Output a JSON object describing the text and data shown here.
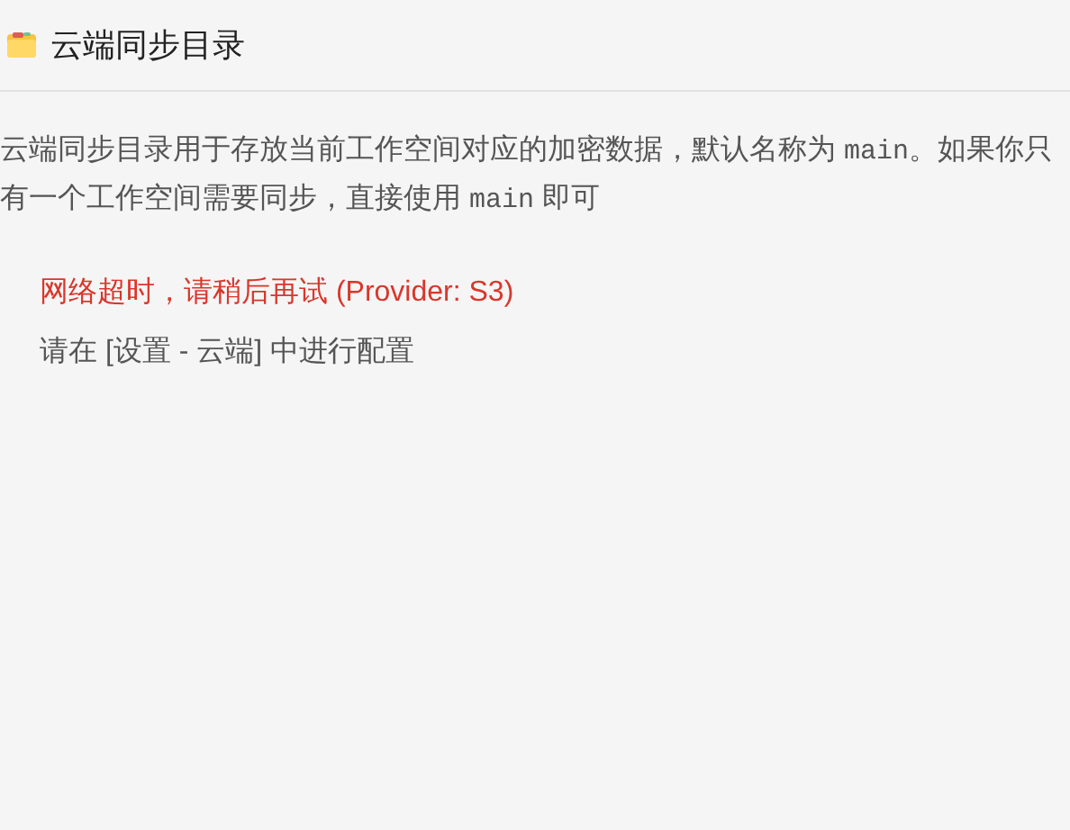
{
  "header": {
    "title": "云端同步目录"
  },
  "description": [
    {
      "kind": "text",
      "text": "云端同步目录用于存放当前工作空间对应的加密数据，默认名称为 "
    },
    {
      "kind": "code",
      "text": "main"
    },
    {
      "kind": "text",
      "text": "。如果你只有一个工作空间需要同步，直接使用 "
    },
    {
      "kind": "code",
      "text": "main"
    },
    {
      "kind": "text",
      "text": " 即可"
    }
  ],
  "messages": [
    {
      "kind": "error",
      "text": "网络超时，请稍后再试 (Provider: S3)"
    },
    {
      "kind": "info",
      "text": "请在 [设置 - 云端] 中进行配置"
    }
  ]
}
